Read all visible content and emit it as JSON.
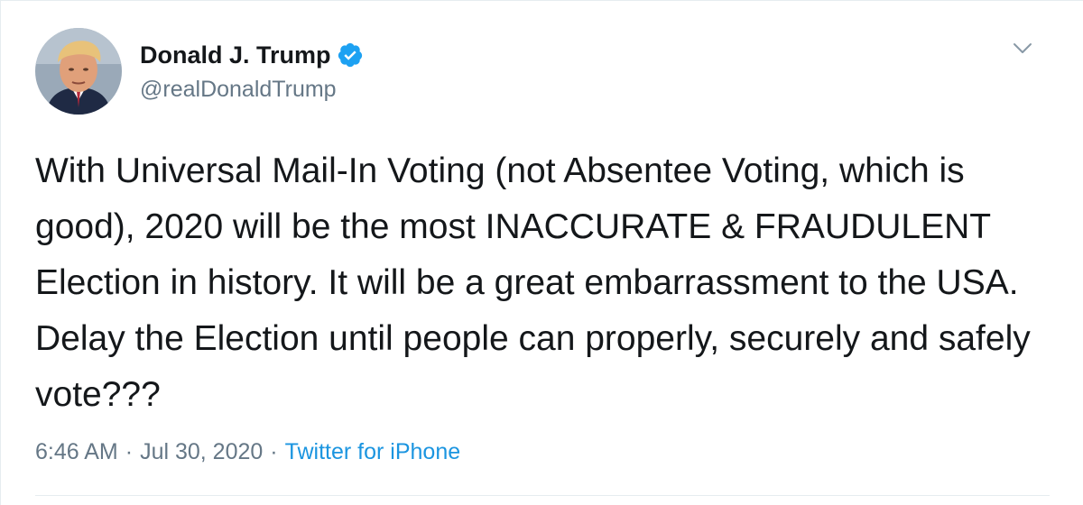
{
  "author": {
    "display_name": "Donald J. Trump",
    "handle": "@realDonaldTrump",
    "avatar_icon": "profile-photo",
    "verified_icon": "verified-badge-icon",
    "verified_color": "#1da1f2"
  },
  "menu": {
    "icon": "chevron-down-icon"
  },
  "tweet": {
    "text": "With Universal Mail-In Voting (not Absentee Voting, which is good), 2020 will be the most INACCURATE & FRAUDULENT Election in history. It will be a great embarrassment to the USA. Delay the Election until people can properly, securely and safely vote???"
  },
  "meta": {
    "time": "6:46 AM",
    "separator": "·",
    "date": "Jul 30, 2020",
    "source": "Twitter for iPhone",
    "source_color": "#1b95e0"
  },
  "colors": {
    "text_primary": "#14171a",
    "text_secondary": "#657786",
    "border": "#e6ecf0"
  }
}
